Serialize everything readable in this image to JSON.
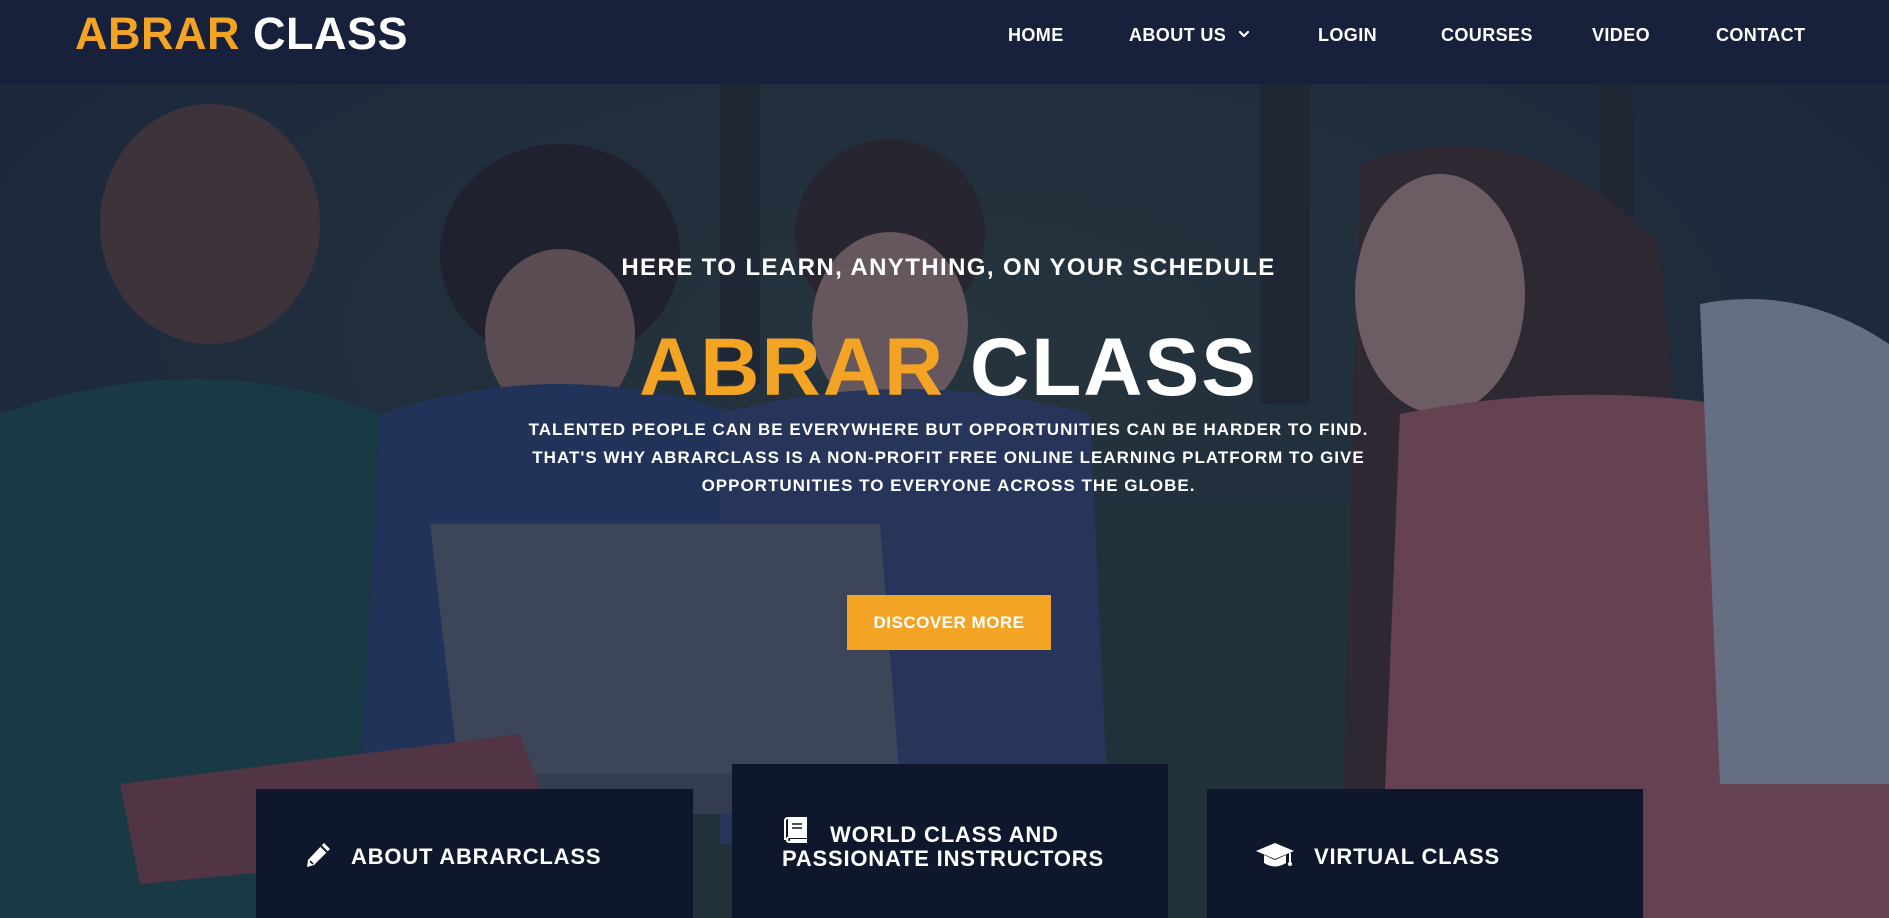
{
  "brand": {
    "name_accent": "ABRAR",
    "name_plain": "CLASS",
    "accent_color": "#f4a424",
    "nav_bg_color": "#18213b",
    "card_bg_color": "#0f172c"
  },
  "nav": {
    "items": [
      {
        "label": "HOME"
      },
      {
        "label": "ABOUT US",
        "icon": "chevron-down-icon"
      },
      {
        "label": "LOGIN"
      },
      {
        "label": "COURSES"
      },
      {
        "label": "VIDEO"
      },
      {
        "label": "CONTACT"
      }
    ]
  },
  "hero": {
    "background_description_icon": "students-with-laptop-photo",
    "tagline": "HERE TO LEARN, ANYTHING, ON YOUR SCHEDULE",
    "title_accent": "ABRAR",
    "title_plain": "CLASS",
    "description_lines": [
      "TALENTED PEOPLE CAN BE EVERYWHERE BUT OPPORTUNITIES CAN BE HARDER TO FIND.",
      "THAT'S WHY ABRARCLASS IS A NON-PROFIT FREE ONLINE LEARNING PLATFORM TO GIVE",
      "OPPORTUNITIES TO EVERYONE ACROSS THE GLOBE."
    ],
    "cta_label": "DISCOVER MORE"
  },
  "features": [
    {
      "icon": "pencil-icon",
      "label_lines": [
        "ABOUT ABRARCLASS"
      ]
    },
    {
      "icon": "book-icon",
      "label_lines": [
        "WORLD CLASS AND",
        "PASSIONATE INSTRUCTORS"
      ]
    },
    {
      "icon": "graduation-cap-icon",
      "label_lines": [
        "VIRTUAL CLASS"
      ]
    }
  ]
}
